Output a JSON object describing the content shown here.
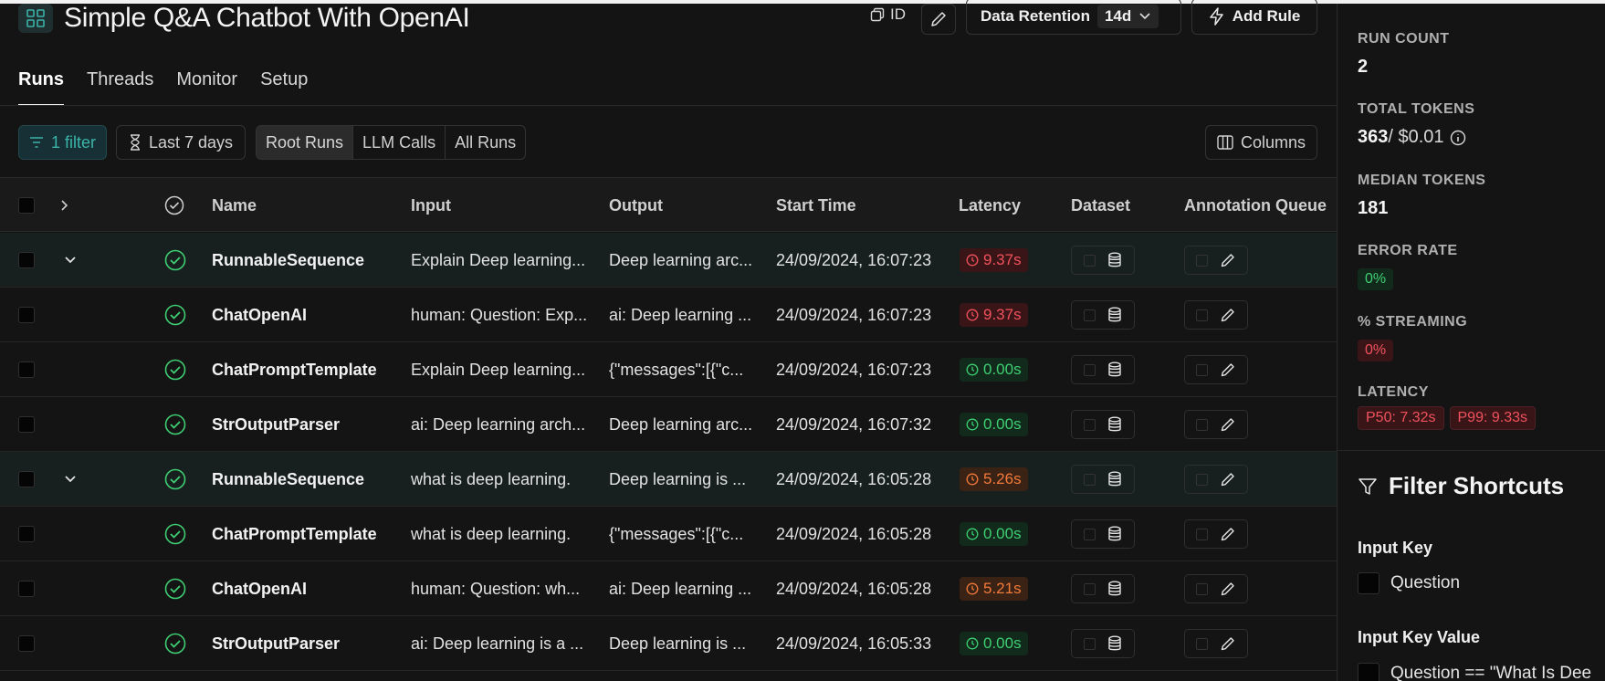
{
  "header": {
    "title": "Simple Q&A Chatbot With OpenAI",
    "id_label": "ID",
    "retention_label": "Data Retention",
    "retention_value": "14d",
    "add_rule_label": "Add Rule"
  },
  "tabs": [
    "Runs",
    "Threads",
    "Monitor",
    "Setup"
  ],
  "filters": {
    "filter_label": "1 filter",
    "time_label": "Last 7 days",
    "segments": [
      "Root Runs",
      "LLM Calls",
      "All Runs"
    ],
    "columns_label": "Columns"
  },
  "table": {
    "headers": {
      "name": "Name",
      "input": "Input",
      "output": "Output",
      "start": "Start Time",
      "latency": "Latency",
      "dataset": "Dataset",
      "annotation": "Annotation Queue"
    },
    "rows": [
      {
        "name": "RunnableSequence",
        "input": "Explain Deep learning...",
        "output": "Deep learning arc...",
        "start": "24/09/2024, 16:07:23",
        "latency": "9.37s"
      },
      {
        "name": "ChatOpenAI",
        "input": "human: Question: Exp...",
        "output": "ai: Deep learning ...",
        "start": "24/09/2024, 16:07:23",
        "latency": "9.37s"
      },
      {
        "name": "ChatPromptTemplate",
        "input": "Explain Deep learning...",
        "output": "{\"messages\":[{\"c...",
        "start": "24/09/2024, 16:07:23",
        "latency": "0.00s"
      },
      {
        "name": "StrOutputParser",
        "input": "ai: Deep learning arch...",
        "output": "Deep learning arc...",
        "start": "24/09/2024, 16:07:32",
        "latency": "0.00s"
      },
      {
        "name": "RunnableSequence",
        "input": "what is deep learning.",
        "output": "Deep learning is ...",
        "start": "24/09/2024, 16:05:28",
        "latency": "5.26s"
      },
      {
        "name": "ChatPromptTemplate",
        "input": "what is deep learning.",
        "output": "{\"messages\":[{\"c...",
        "start": "24/09/2024, 16:05:28",
        "latency": "0.00s"
      },
      {
        "name": "ChatOpenAI",
        "input": "human: Question: wh...",
        "output": "ai: Deep learning ...",
        "start": "24/09/2024, 16:05:28",
        "latency": "5.21s"
      },
      {
        "name": "StrOutputParser",
        "input": "ai: Deep learning is a ...",
        "output": "Deep learning is ...",
        "start": "24/09/2024, 16:05:33",
        "latency": "0.00s"
      }
    ]
  },
  "stats": {
    "run_count_label": "RUN COUNT",
    "run_count": "2",
    "total_tokens_label": "TOTAL TOKENS",
    "total_tokens": "363",
    "total_cost": " / $0.01",
    "median_tokens_label": "MEDIAN TOKENS",
    "median_tokens": "181",
    "error_rate_label": "ERROR RATE",
    "error_rate": "0%",
    "streaming_label": "% STREAMING",
    "streaming": "0%",
    "latency_label": "LATENCY",
    "p50": "P50: 7.32s",
    "p99": "P99: 9.33s"
  },
  "filter_shortcuts": {
    "title": "Filter Shortcuts",
    "input_key_label": "Input Key",
    "input_key_option": "Question",
    "input_key_value_label": "Input Key Value",
    "input_key_value_option": "Question == \"What Is Dee"
  },
  "colors": {
    "latency_red": "#f0525c",
    "latency_orange": "#f27a3a",
    "latency_green": "#3fce72",
    "success_green": "#3fce72",
    "accent_teal": "#3bb3a8"
  }
}
